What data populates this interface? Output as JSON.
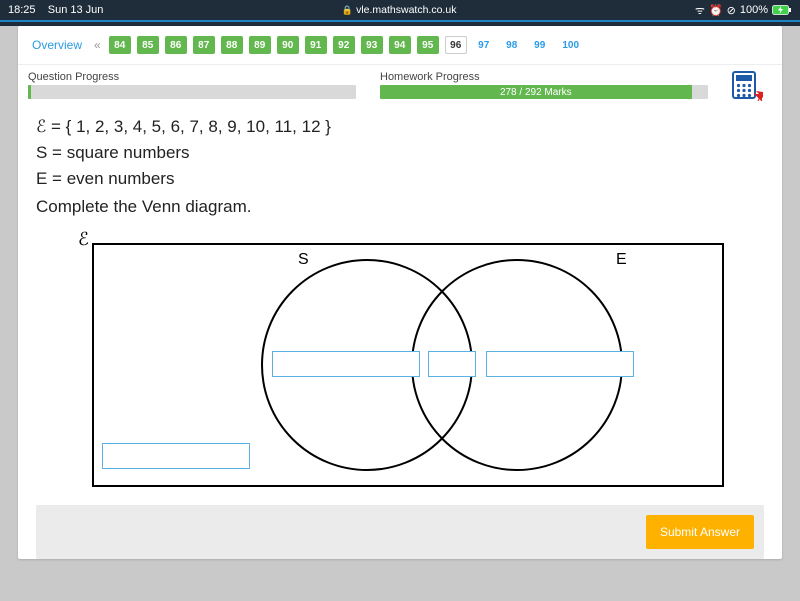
{
  "status": {
    "time": "18:25",
    "date": "Sun 13 Jun",
    "url": "vle.mathswatch.co.uk",
    "battery": "100%"
  },
  "nav": {
    "overview": "Overview",
    "sep": "«",
    "items": [
      {
        "n": "84",
        "state": "done"
      },
      {
        "n": "85",
        "state": "done"
      },
      {
        "n": "86",
        "state": "done"
      },
      {
        "n": "87",
        "state": "done"
      },
      {
        "n": "88",
        "state": "done"
      },
      {
        "n": "89",
        "state": "done"
      },
      {
        "n": "90",
        "state": "done"
      },
      {
        "n": "91",
        "state": "done"
      },
      {
        "n": "92",
        "state": "done"
      },
      {
        "n": "93",
        "state": "done"
      },
      {
        "n": "94",
        "state": "done"
      },
      {
        "n": "95",
        "state": "done"
      },
      {
        "n": "96",
        "state": "current"
      },
      {
        "n": "97",
        "state": "future"
      },
      {
        "n": "98",
        "state": "future"
      },
      {
        "n": "99",
        "state": "future"
      },
      {
        "n": "100",
        "state": "future"
      }
    ]
  },
  "progress": {
    "q_label": "Question Progress",
    "hw_label": "Homework Progress",
    "hw_text": "278 / 292 Marks",
    "hw_pct": 95
  },
  "question": {
    "line1": "ℰ = { 1, 2, 3, 4, 5, 6, 7, 8, 9, 10, 11, 12 }",
    "line2": "S = square numbers",
    "line3": "E = even numbers",
    "instruction": "Complete the Venn diagram."
  },
  "venn": {
    "epsilon": "ℰ",
    "S": "S",
    "E": "E"
  },
  "submit": "Submit Answer"
}
